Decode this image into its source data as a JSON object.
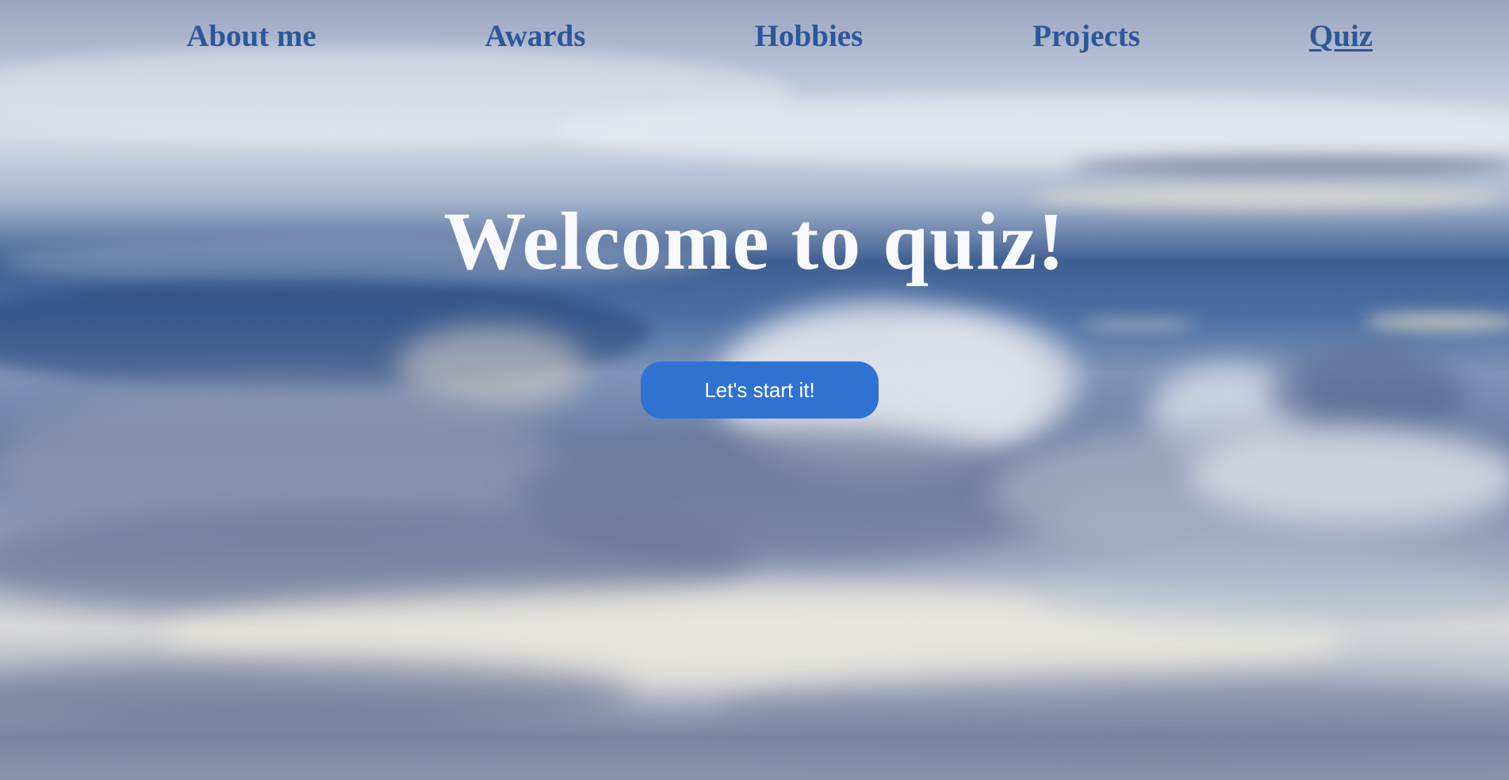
{
  "nav": {
    "items": [
      {
        "label": "About me",
        "active": false
      },
      {
        "label": "Awards",
        "active": false
      },
      {
        "label": "Hobbies",
        "active": false
      },
      {
        "label": "Projects",
        "active": false
      },
      {
        "label": "Quiz",
        "active": true
      }
    ]
  },
  "hero": {
    "title": "Welcome to quiz!",
    "start_button_label": "Let's start it!"
  },
  "colors": {
    "nav_link": "#2d5799",
    "title": "#f7f8fb",
    "button_bg": "#2f72d2",
    "button_text": "#ffffff"
  },
  "background": {
    "description_icon": "cloudy-sky-image"
  }
}
